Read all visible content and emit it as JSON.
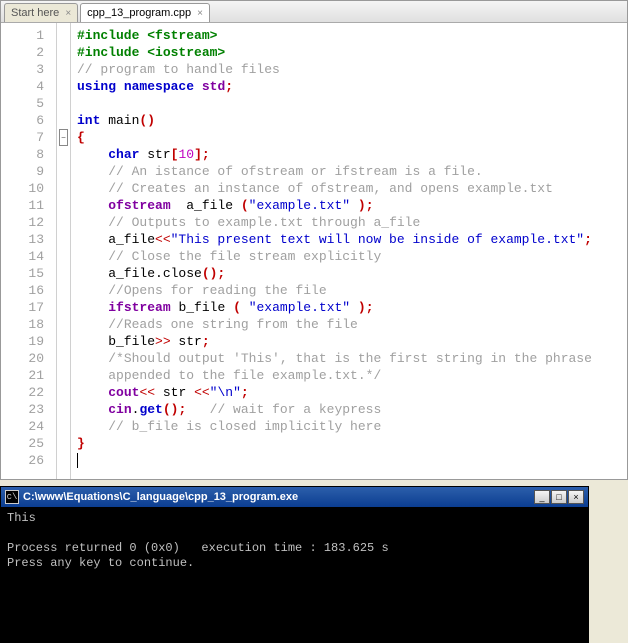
{
  "tabs": [
    {
      "label": "Start here",
      "active": false
    },
    {
      "label": "cpp_13_program.cpp",
      "active": true
    }
  ],
  "code_lines": [
    [
      [
        "kw-green",
        "#include <fstream>"
      ]
    ],
    [
      [
        "kw-green",
        "#include <iostream>"
      ]
    ],
    [
      [
        "comment",
        "// program to handle files"
      ]
    ],
    [
      [
        "kw-blue",
        "using"
      ],
      [
        "ident",
        " "
      ],
      [
        "kw-blue",
        "namespace"
      ],
      [
        "ident",
        " "
      ],
      [
        "kw-purple",
        "std"
      ],
      [
        "brace",
        ";"
      ]
    ],
    [],
    [
      [
        "kw-blue",
        "int"
      ],
      [
        "ident",
        " main"
      ],
      [
        "brace",
        "()"
      ]
    ],
    [
      [
        "brace",
        "{"
      ]
    ],
    [
      [
        "ident",
        "    "
      ],
      [
        "kw-blue",
        "char"
      ],
      [
        "ident",
        " str"
      ],
      [
        "brace",
        "["
      ],
      [
        "num",
        "10"
      ],
      [
        "brace",
        "];"
      ]
    ],
    [
      [
        "ident",
        "    "
      ],
      [
        "comment",
        "// An istance of ofstream or ifstream is a file."
      ]
    ],
    [
      [
        "ident",
        "    "
      ],
      [
        "comment",
        "// Creates an instance of ofstream, and opens example.txt"
      ]
    ],
    [
      [
        "ident",
        "    "
      ],
      [
        "kw-purple",
        "ofstream"
      ],
      [
        "ident",
        "  a_file "
      ],
      [
        "brace",
        "("
      ],
      [
        "str",
        "\"example.txt\""
      ],
      [
        "ident",
        " "
      ],
      [
        "brace",
        ");"
      ]
    ],
    [
      [
        "ident",
        "    "
      ],
      [
        "comment",
        "// Outputs to example.txt through a_file"
      ]
    ],
    [
      [
        "ident",
        "    a_file"
      ],
      [
        "op",
        "<<"
      ],
      [
        "str",
        "\"This present text will now be inside of example.txt\""
      ],
      [
        "brace",
        ";"
      ]
    ],
    [
      [
        "ident",
        "    "
      ],
      [
        "comment",
        "// Close the file stream explicitly"
      ]
    ],
    [
      [
        "ident",
        "    a_file.close"
      ],
      [
        "brace",
        "();"
      ]
    ],
    [
      [
        "ident",
        "    "
      ],
      [
        "comment",
        "//Opens for reading the file"
      ]
    ],
    [
      [
        "ident",
        "    "
      ],
      [
        "kw-purple",
        "ifstream"
      ],
      [
        "ident",
        " b_file "
      ],
      [
        "brace",
        "("
      ],
      [
        "ident",
        " "
      ],
      [
        "str",
        "\"example.txt\""
      ],
      [
        "ident",
        " "
      ],
      [
        "brace",
        ");"
      ]
    ],
    [
      [
        "ident",
        "    "
      ],
      [
        "comment",
        "//Reads one string from the file"
      ]
    ],
    [
      [
        "ident",
        "    b_file"
      ],
      [
        "op",
        ">>"
      ],
      [
        "ident",
        " str"
      ],
      [
        "brace",
        ";"
      ]
    ],
    [
      [
        "ident",
        "    "
      ],
      [
        "comment",
        "/*Should output 'This', that is the first string in the phrase"
      ]
    ],
    [
      [
        "ident",
        "    "
      ],
      [
        "comment",
        "appended to the file example.txt.*/"
      ]
    ],
    [
      [
        "ident",
        "    "
      ],
      [
        "kw-purple",
        "cout"
      ],
      [
        "op",
        "<<"
      ],
      [
        "ident",
        " str "
      ],
      [
        "op",
        "<<"
      ],
      [
        "str",
        "\"\\n\""
      ],
      [
        "brace",
        ";"
      ]
    ],
    [
      [
        "ident",
        "    "
      ],
      [
        "kw-purple",
        "cin"
      ],
      [
        "ident",
        "."
      ],
      [
        "kw-blue",
        "get"
      ],
      [
        "brace",
        "();"
      ],
      [
        "ident",
        "   "
      ],
      [
        "comment",
        "// wait for a keypress"
      ]
    ],
    [
      [
        "ident",
        "    "
      ],
      [
        "comment",
        "// b_file is closed implicitly here"
      ]
    ],
    [
      [
        "brace",
        "}"
      ]
    ],
    []
  ],
  "fold_at": 7,
  "console": {
    "title_prefix": "C:\\",
    "title": "C:\\www\\Equations\\C_language\\cpp_13_program.exe",
    "lines": [
      "This",
      "",
      "Process returned 0 (0x0)   execution time : 183.625 s",
      "Press any key to continue."
    ]
  }
}
